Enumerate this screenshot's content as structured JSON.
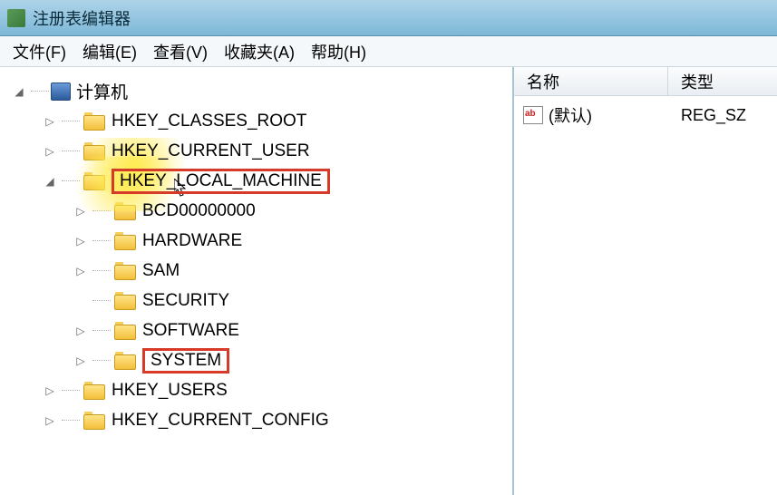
{
  "window": {
    "title": "注册表编辑器"
  },
  "menubar": {
    "file": "文件(F)",
    "edit": "编辑(E)",
    "view": "查看(V)",
    "fav": "收藏夹(A)",
    "help": "帮助(H)"
  },
  "tree": {
    "root": "计算机",
    "hkcr": "HKEY_CLASSES_ROOT",
    "hkcu": "HKEY_CURRENT_USER",
    "hklm": "HKEY_LOCAL_MACHINE",
    "hklm_children": {
      "bcd": "BCD00000000",
      "hardware": "HARDWARE",
      "sam": "SAM",
      "security": "SECURITY",
      "software": "SOFTWARE",
      "system": "SYSTEM"
    },
    "hku": "HKEY_USERS",
    "hkcc": "HKEY_CURRENT_CONFIG"
  },
  "list": {
    "header_name": "名称",
    "header_type": "类型",
    "rows": [
      {
        "name": "(默认)",
        "type": "REG_SZ"
      }
    ]
  }
}
